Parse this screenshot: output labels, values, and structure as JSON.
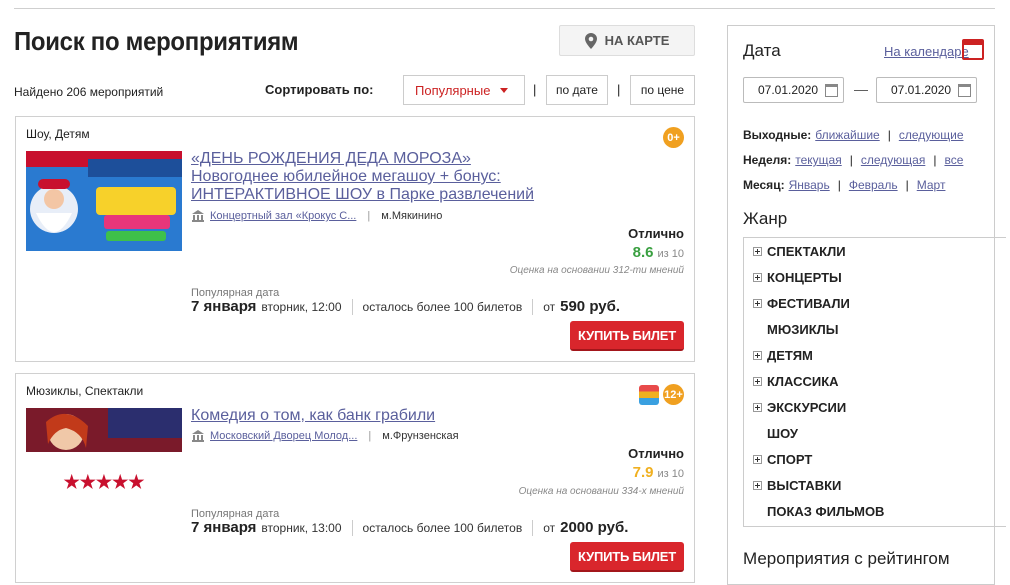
{
  "page": {
    "title": "Поиск по мероприятиям",
    "map_button": "НА КАРТЕ",
    "found": "Найдено 206 мероприятий",
    "sort_label": "Сортировать по:",
    "sort_selected": "Популярные",
    "sort_date": "по дате",
    "sort_price": "по цене",
    "pipe": "|"
  },
  "events": [
    {
      "category": "Шоу, Детям",
      "age": "0+",
      "title_lines": [
        "«ДЕНЬ РОЖДЕНИЯ ДЕДА МОРОЗА»",
        "Новогоднее юбилейное мегашоу + бонус:",
        "ИНТЕРАКТИВНОЕ ШОУ в Парке развлечений"
      ],
      "venue": "Концертный зал «Крокус С...",
      "metro": "м.Мякинино",
      "rating_label": "Отлично",
      "rating_value": "8.6",
      "rating_of": "из 10",
      "rating_note": "Оценка на основании 312-ти мнений",
      "popular_label": "Популярная дата",
      "date": "7 января",
      "weekday_time": "вторник, 12:00",
      "tickets": "осталось более 100 билетов",
      "price_from": "от",
      "price": "590 руб.",
      "buy": "КУПИТЬ БИЛЕТ",
      "rating_color": "#3aa041"
    },
    {
      "category": "Мюзиклы, Спектакли",
      "age": "12+",
      "title_lines": [
        "Комедия о том, как банк грабили"
      ],
      "venue": "Московский Дворец Молод...",
      "metro": "м.Фрунзенская",
      "rating_label": "Отлично",
      "rating_value": "7.9",
      "rating_of": "из 10",
      "rating_note": "Оценка на основании 334-х мнений",
      "popular_label": "Популярная дата",
      "date": "7 января",
      "weekday_time": "вторник, 13:00",
      "tickets": "осталось более 100 билетов",
      "price_from": "от",
      "price": "2000 руб.",
      "buy": "КУПИТЬ БИЛЕТ",
      "rating_color": "#f0b020"
    }
  ],
  "sidebar": {
    "date_title": "Дата",
    "calendar_link": "На календаре",
    "date_from": "07.01.2020",
    "date_to": "07.01.2020",
    "dash": "—",
    "weekends_label": "Выходные:",
    "weekends": [
      "ближайшие",
      "следующие"
    ],
    "week_label": "Неделя:",
    "week": [
      "текущая",
      "следующая",
      "все"
    ],
    "month_label": "Месяц:",
    "month": [
      "Январь",
      "Февраль",
      "Март"
    ],
    "genre_title": "Жанр",
    "genres": [
      {
        "label": "СПЕКТАКЛИ",
        "expandable": true
      },
      {
        "label": "КОНЦЕРТЫ",
        "expandable": true
      },
      {
        "label": "ФЕСТИВАЛИ",
        "expandable": true
      },
      {
        "label": "МЮЗИКЛЫ",
        "expandable": false
      },
      {
        "label": "ДЕТЯМ",
        "expandable": true
      },
      {
        "label": "КЛАССИКА",
        "expandable": true
      },
      {
        "label": "ЭКСКУРСИИ",
        "expandable": true
      },
      {
        "label": "ШОУ",
        "expandable": false
      },
      {
        "label": "СПОРТ",
        "expandable": true
      },
      {
        "label": "ВЫСТАВКИ",
        "expandable": true
      },
      {
        "label": "ПОКАЗ ФИЛЬМОВ",
        "expandable": false
      }
    ],
    "rating_title": "Мероприятия с рейтингом"
  },
  "colors": {
    "accent": "#d9262c",
    "link": "#5a5f9c"
  }
}
